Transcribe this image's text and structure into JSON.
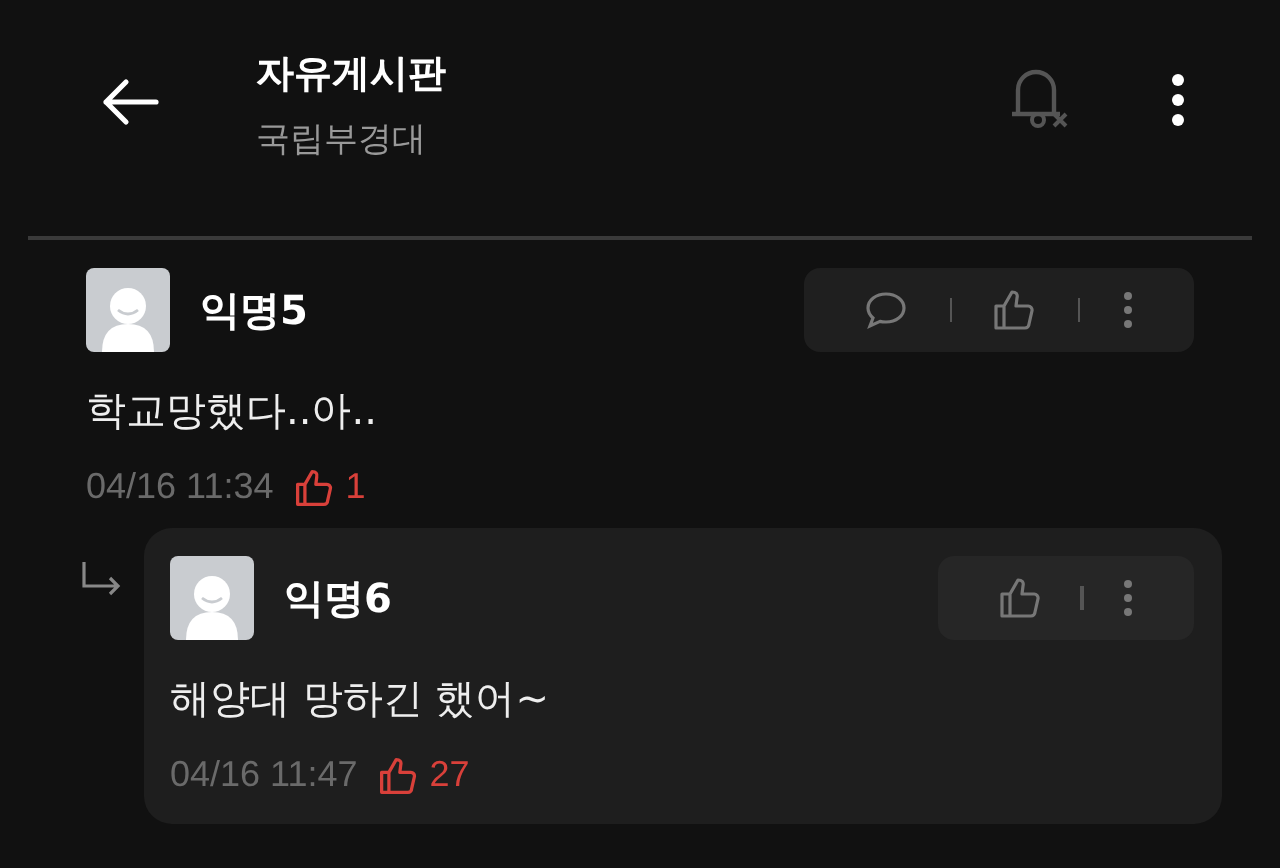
{
  "header": {
    "title": "자유게시판",
    "subtitle": "국립부경대"
  },
  "comments": [
    {
      "kind": "comment",
      "author": "익명5",
      "text": "학교망했다..아..",
      "time": "04/16 11:34",
      "likes": "1"
    },
    {
      "kind": "reply",
      "author": "익명6",
      "text": "해양대 망하긴 했어~",
      "time": "04/16 11:47",
      "likes": "27"
    }
  ]
}
